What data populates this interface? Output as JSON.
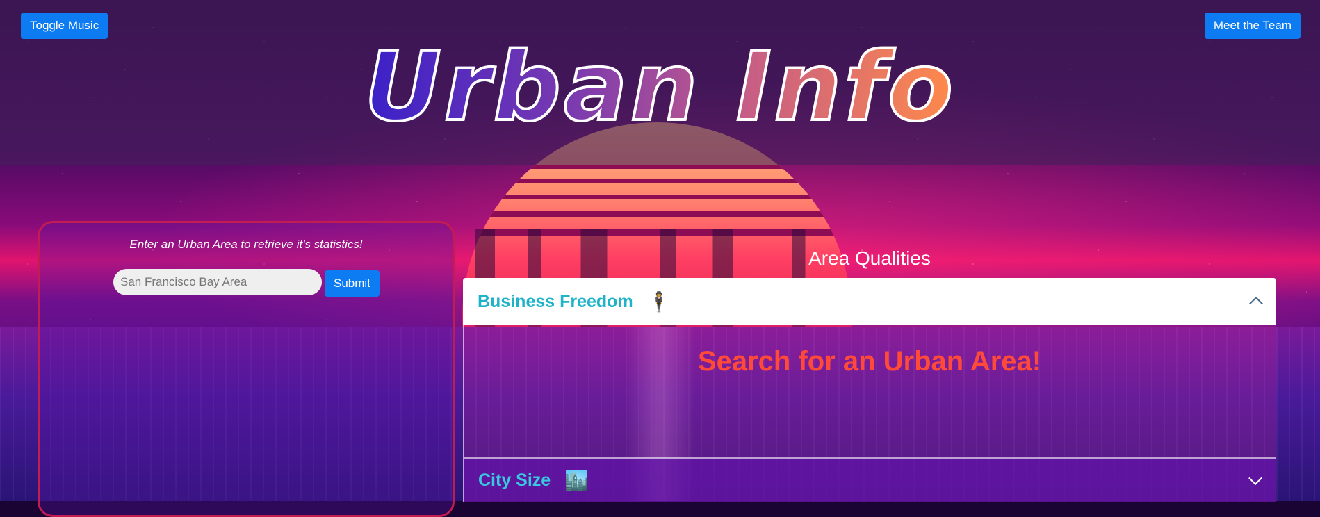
{
  "header": {
    "title": "Urban Info",
    "toggle_music_label": "Toggle Music",
    "meet_team_label": "Meet the Team"
  },
  "search": {
    "hint": "Enter an Urban Area to retrieve it's statistics!",
    "placeholder": "San Francisco Bay Area",
    "submit_label": "Submit"
  },
  "qualities": {
    "title": "Area Qualities",
    "items": [
      {
        "label": "Business Freedom",
        "emoji": "🕴️",
        "expanded": true,
        "message": "Search for an Urban Area!"
      },
      {
        "label": "City Size",
        "emoji": "🏙️",
        "expanded": false
      }
    ]
  },
  "colors": {
    "button_blue": "#0d7cf2",
    "accordion_label": "#1fb3c8",
    "placeholder_message": "#ff4a3a",
    "panel_border": "#c21d52"
  }
}
